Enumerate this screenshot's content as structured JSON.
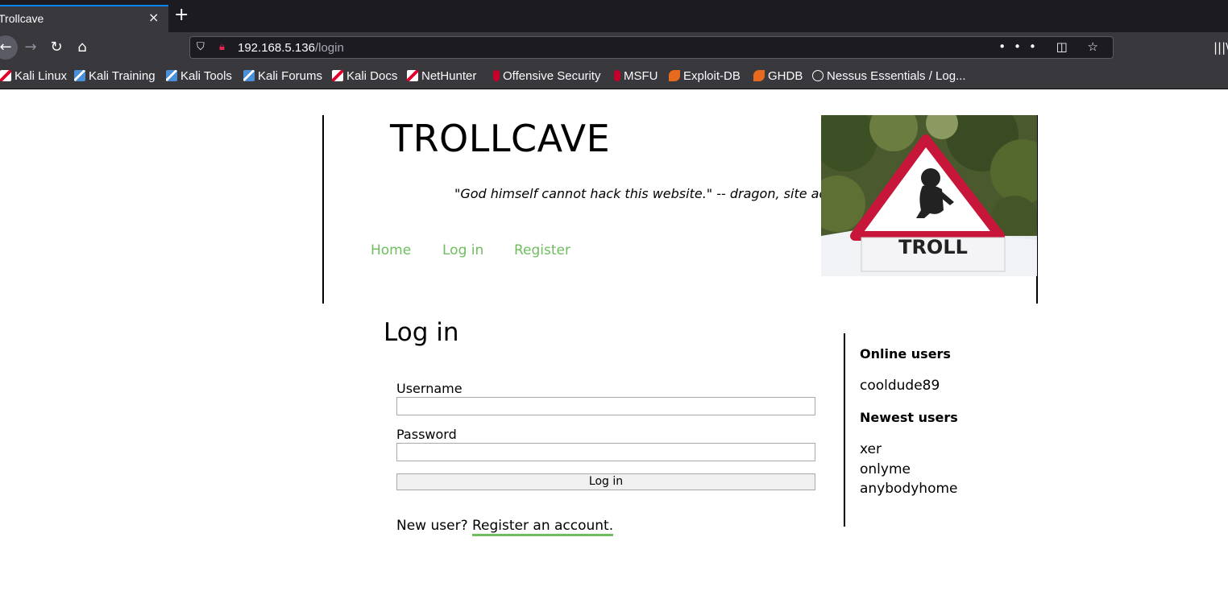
{
  "browser": {
    "tab_title": "Trollcave",
    "tab_close": "×",
    "new_tab": "+",
    "url_host": "192.168.5.136",
    "url_path": "/login",
    "url_actions": "••• ◫ ☆",
    "library": "|||\\",
    "bookmarks": [
      {
        "label": "Kali Linux",
        "icon": "kali-icon"
      },
      {
        "label": "Kali Training",
        "icon": "kali-training-icon"
      },
      {
        "label": "Kali Tools",
        "icon": "kali-tools-icon"
      },
      {
        "label": "Kali Forums",
        "icon": "kali-forums-icon"
      },
      {
        "label": "Kali Docs",
        "icon": "kali-docs-icon"
      },
      {
        "label": "NetHunter",
        "icon": "nethunter-icon"
      },
      {
        "label": "Offensive Security",
        "icon": "offsec-icon"
      },
      {
        "label": "MSFU",
        "icon": "msfu-icon"
      },
      {
        "label": "Exploit-DB",
        "icon": "exploitdb-icon"
      },
      {
        "label": "GHDB",
        "icon": "ghdb-icon"
      },
      {
        "label": "Nessus Essentials / Log...",
        "icon": "globe-icon"
      }
    ]
  },
  "site": {
    "title": "TROLLCAVE",
    "tagline": "\"God himself cannot hack this website.\" -- dragon, site admin",
    "nav": [
      "Home",
      "Log in",
      "Register"
    ],
    "sign_text": "TROLL",
    "link_color": "#6ebd5f"
  },
  "login": {
    "heading": "Log in",
    "username_label": "Username",
    "password_label": "Password",
    "button_label": "Log in",
    "new_user_text": "New user?",
    "register_link": "Register an account."
  },
  "sidebar": {
    "online_heading": "Online users",
    "online_users": [
      "cooldude89"
    ],
    "newest_heading": "Newest users",
    "newest_users": [
      "xer",
      "onlyme",
      "anybodyhome"
    ]
  }
}
